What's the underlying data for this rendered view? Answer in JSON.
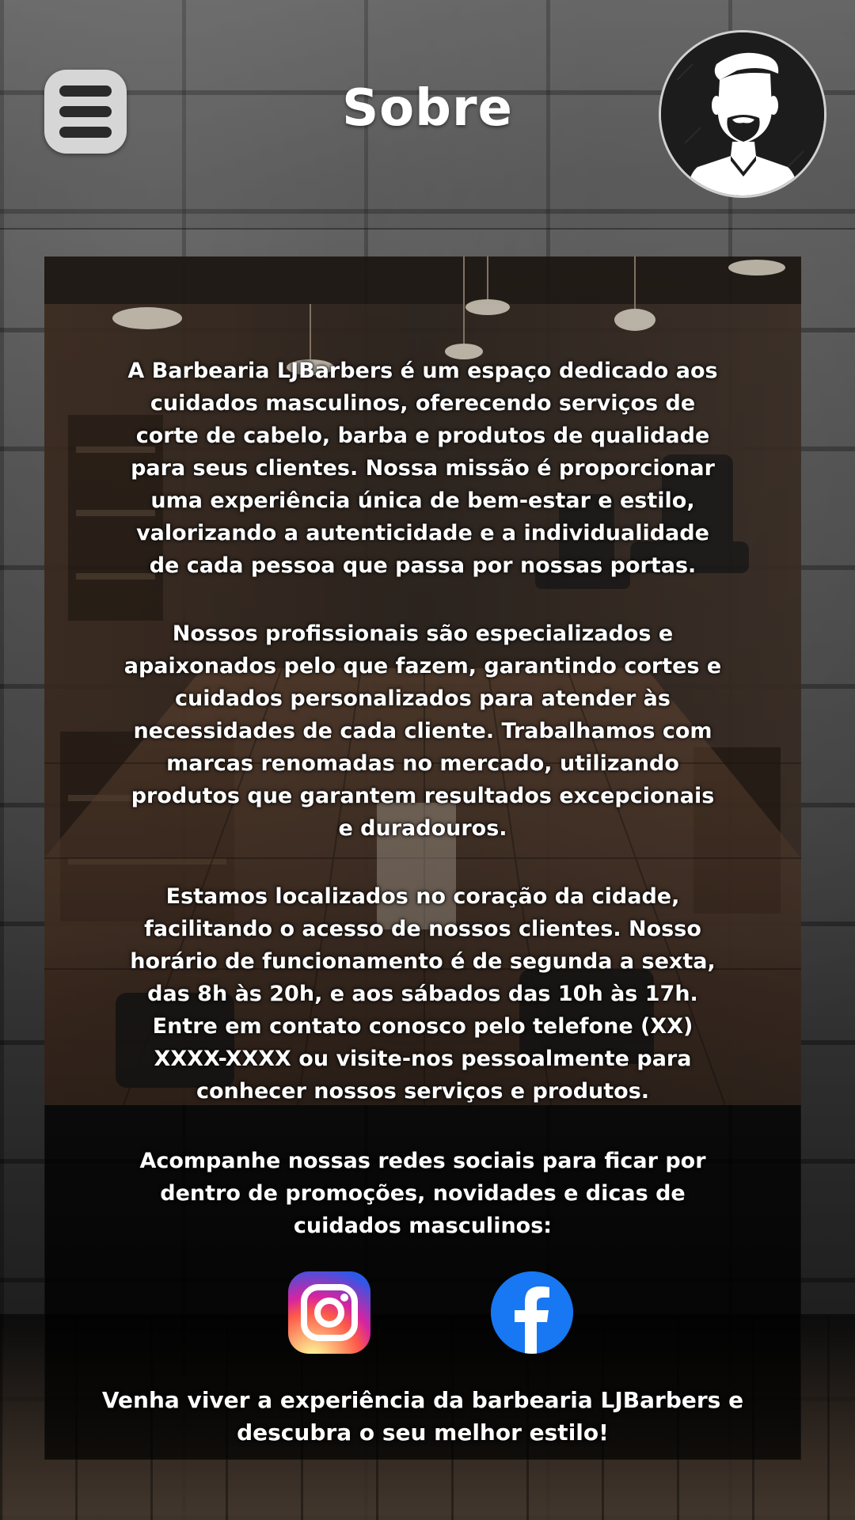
{
  "header": {
    "title": "Sobre",
    "menu_icon": "hamburger-menu-icon",
    "logo_icon": "bearded-man-logo-icon"
  },
  "content": {
    "paragraph_1": "A Barbearia LJBarbers é um espaço dedicado aos cuidados masculinos, oferecendo serviços de corte de cabelo, barba e produtos de qualidade para seus clientes. Nossa missão é proporcionar uma experiência única de bem-estar e estilo, valorizando a autenticidade e a individualidade de cada pessoa que passa por nossas portas.",
    "paragraph_2": "Nossos profissionais são especializados e apaixonados pelo que fazem, garantindo cortes e cuidados personalizados para atender às necessidades de cada cliente. Trabalhamos com marcas renomadas no mercado, utilizando produtos que garantem resultados excepcionais e duradouros.",
    "paragraph_3": "Estamos localizados no coração da cidade, facilitando o acesso de nossos clientes. Nosso horário de funcionamento é de segunda a sexta, das 8h às 20h, e aos sábados das 10h às 17h. Entre em contato conosco pelo telefone (XX) XXXX-XXXX ou visite-nos pessoalmente para conhecer nossos serviços e produtos.",
    "social_intro": "Acompanhe nossas redes sociais para ficar por dentro de promoções, novidades e dicas de cuidados masculinos:",
    "closing": "Venha viver a experiência da barbearia LJBarbers e descubra o seu melhor estilo!"
  },
  "social": {
    "instagram_icon": "instagram-icon",
    "facebook_icon": "facebook-icon"
  },
  "colors": {
    "menu_button_bg": "#d6d6d6",
    "facebook_blue": "#1877F2",
    "text": "#ffffff"
  }
}
